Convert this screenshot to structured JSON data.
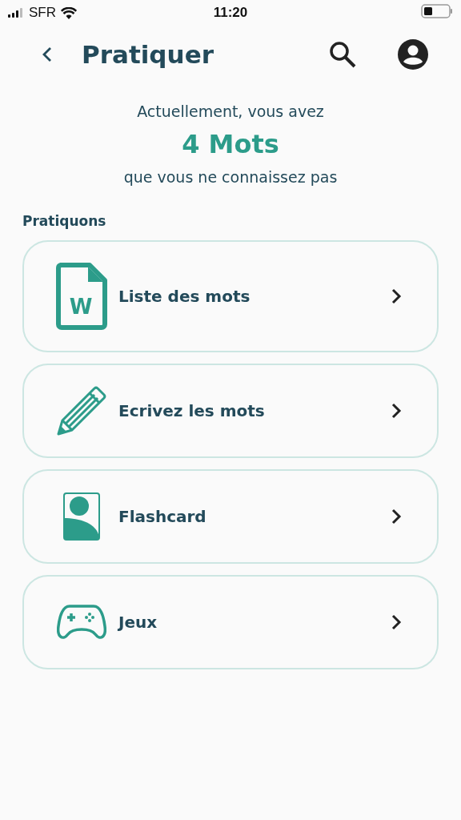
{
  "status_bar": {
    "carrier": "SFR",
    "time": "11:20"
  },
  "header": {
    "title": "Pratiquer"
  },
  "summary": {
    "before": "Actuellement, vous avez",
    "count": "4 Mots",
    "after": "que vous ne connaissez pas"
  },
  "section_title": "Pratiquons",
  "items": [
    {
      "kind": "document",
      "icon_letter": "W",
      "label": "Liste des mots"
    },
    {
      "kind": "pencil",
      "label": "Ecrivez les mots"
    },
    {
      "kind": "card",
      "label": "Flashcard"
    },
    {
      "kind": "gamepad",
      "label": "Jeux"
    }
  ]
}
